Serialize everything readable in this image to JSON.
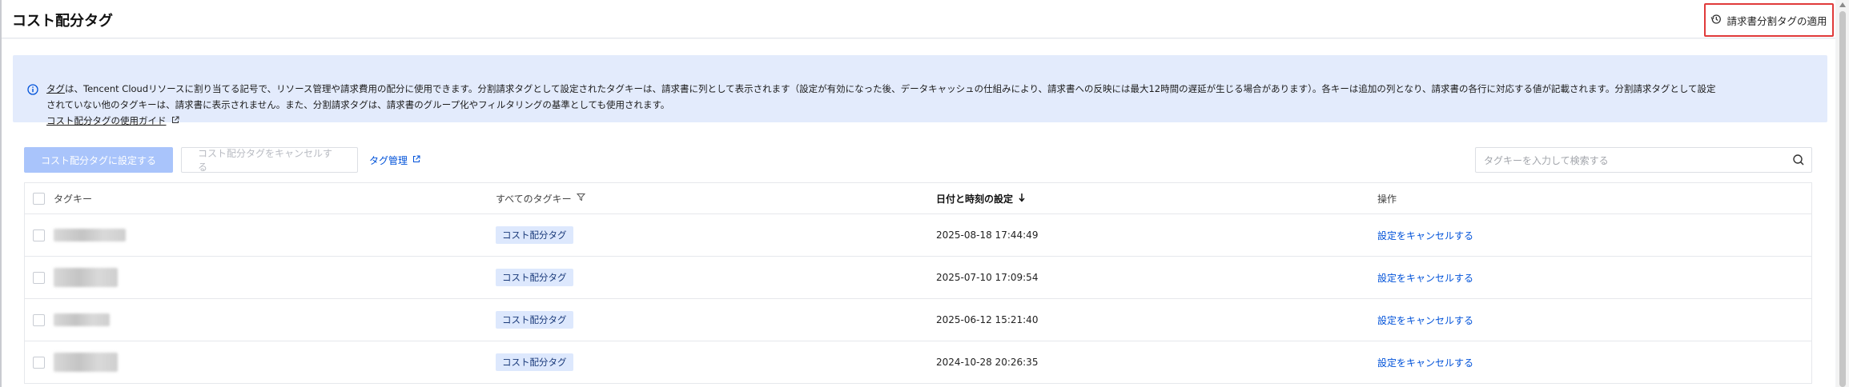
{
  "header": {
    "title": "コスト配分タグ",
    "apply_button_label": "請求書分割タグの適用",
    "apply_icon": "history-icon"
  },
  "notice": {
    "info_icon": "info-icon",
    "line1_tag_link": "タグ",
    "line1_text": "は、Tencent Cloudリソースに割り当てる記号で、リソース管理や請求費用の配分に使用できます。分割請求タグとして設定されたタグキーは、請求書に列として表示されます（設定が有効になった後、データキャッシュの仕組みにより、請求書への反映には最大12時間の遅延が生じる場合があります）。各キーは追加の列となり、請求書の各行に対応する値が記載されます。分割請求タグとして設定",
    "line2_text": "されていない他のタグキーは、請求書に表示されません。また、分割請求タグは、請求書のグループ化やフィルタリングの基準としても使用されます。",
    "guide_link": "コスト配分タグの使用ガイド",
    "guide_icon": "external-link-icon"
  },
  "toolbar": {
    "set_button": "コスト配分タグに設定する",
    "cancel_button": "コスト配分タグをキャンセルする",
    "tag_manage_link": "タグ管理",
    "tag_manage_icon": "external-link-icon"
  },
  "search": {
    "placeholder": "タグキーを入力して検索する",
    "icon": "search-icon"
  },
  "table": {
    "headers": {
      "key": "タグキー",
      "all": "すべてのタグキー",
      "date": "日付と時刻の設定",
      "op": "操作"
    },
    "filter_icon": "filter-icon",
    "sort_icon": "arrow-down-icon",
    "rows": [
      {
        "badge": "コスト配分タグ",
        "date": "2025-08-18 17:44:49",
        "op": "設定をキャンセルする"
      },
      {
        "badge": "コスト配分タグ",
        "date": "2025-07-10 17:09:54",
        "op": "設定をキャンセルする"
      },
      {
        "badge": "コスト配分タグ",
        "date": "2025-06-12 15:21:40",
        "op": "設定をキャンセルする"
      },
      {
        "badge": "コスト配分タグ",
        "date": "2024-10-28 20:26:35",
        "op": "設定をキャンセルする"
      }
    ]
  },
  "colors": {
    "accent": "#0052d9",
    "notice_bg": "#e3ebfc",
    "highlight_border": "#e03a3a",
    "badge_bg": "#dde8fd"
  }
}
